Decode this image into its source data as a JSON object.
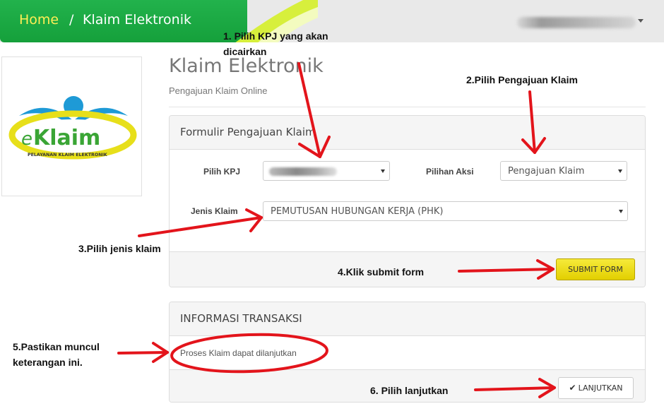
{
  "breadcrumb": {
    "home": "Home",
    "separator": "/",
    "current": "Klaim Elektronik"
  },
  "logo": {
    "brand_e": "e",
    "brand_rest": "Klaim",
    "tagline": "PELAYANAN KLAIM ELEKTRONIK"
  },
  "header": {
    "title": "Klaim Elektronik",
    "subtitle": "Pengajuan Klaim Online"
  },
  "form_panel": {
    "title": "Formulir Pengajuan Klaim",
    "kpj_label": "Pilih KPJ",
    "kpj_value": "",
    "action_label": "Pilihan Aksi",
    "action_value": "Pengajuan Klaim",
    "claim_type_label": "Jenis Klaim",
    "claim_type_value": "PEMUTUSAN HUBUNGAN KERJA (PHK)",
    "submit_label": "SUBMIT FORM"
  },
  "info_panel": {
    "title": "INFORMASI TRANSAKSI",
    "message": "Proses Klaim dapat dilanjutkan",
    "next_label": "LANJUTKAN"
  },
  "annotations": {
    "step1_line1": "1. Pilih KPJ yang akan",
    "step1_line2": "dicairkan",
    "step2": "2.Pilih Pengajuan Klaim",
    "step3": "3.Pilih jenis klaim",
    "step4": "4.Klik submit form",
    "step5_line1": "5.Pastikan muncul",
    "step5_line2": "keterangan ini.",
    "step6": "6. Pilih lanjutkan"
  },
  "colors": {
    "nav_green": "#15a03b",
    "home_link": "#ffee55",
    "submit_yellow": "#e9d800",
    "annotation_red": "#e3141b"
  },
  "icons": {
    "check": "check-icon",
    "caret": "caret-down-icon"
  }
}
